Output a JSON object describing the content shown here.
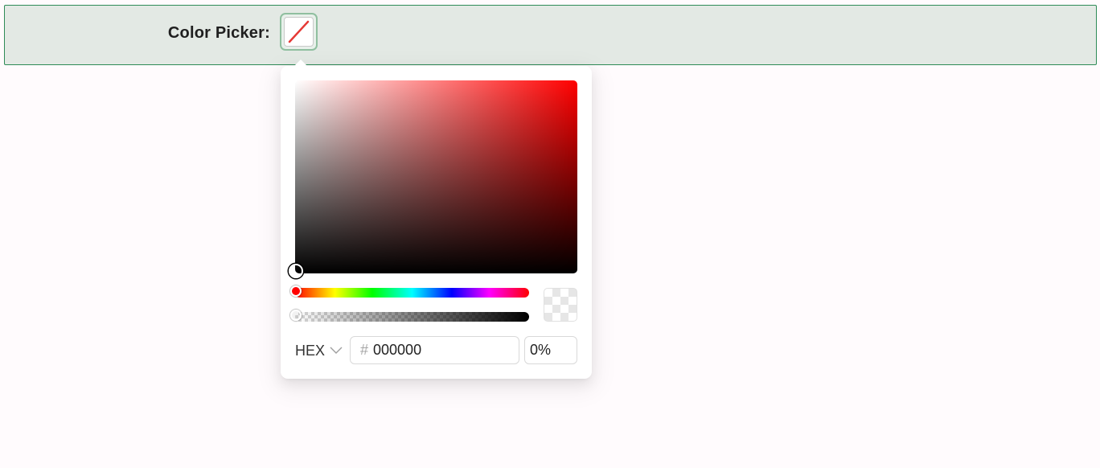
{
  "form": {
    "label": "Color Picker",
    "colon": ":",
    "trigger_state": "no-color"
  },
  "picker": {
    "hue_color": "#ff0000",
    "hue_value": 0,
    "alpha_value": 0,
    "format_label": "HEX",
    "hex_prefix": "#",
    "hex_value": "000000",
    "alpha_label": "0%"
  },
  "colors": {
    "form_background": "#e3e9e4",
    "form_border": "#2e8b57",
    "trigger_slash": "#e53935"
  },
  "icons": {
    "trigger": "no-color-slash-icon",
    "format": "chevron-down-icon"
  }
}
